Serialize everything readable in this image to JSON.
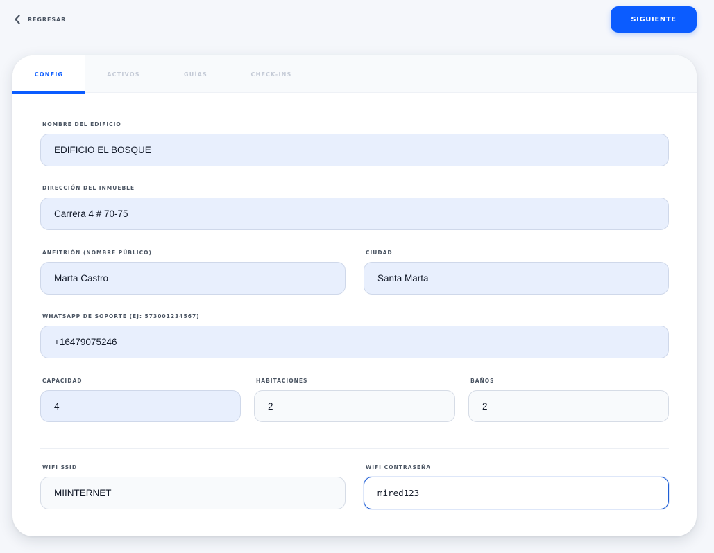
{
  "header": {
    "back_label": "REGRESAR",
    "next_label": "SIGUIENTE"
  },
  "tabs": [
    {
      "label": "CONFIG",
      "active": true
    },
    {
      "label": "ACTIVOS",
      "active": false
    },
    {
      "label": "GUÍAS",
      "active": false
    },
    {
      "label": "CHECK-INS",
      "active": false
    }
  ],
  "form": {
    "building_name": {
      "label": "NOMBRE DEL EDIFICIO",
      "value": "EDIFICIO EL BOSQUE"
    },
    "address": {
      "label": "DIRECCIÓN DEL INMUEBLE",
      "value": "Carrera 4 # 70-75"
    },
    "host": {
      "label": "ANFITRIÓN (NOMBRE PÚBLICO)",
      "value": "Marta Castro"
    },
    "city": {
      "label": "CIUDAD",
      "value": "Santa Marta"
    },
    "whatsapp": {
      "label": "WHATSAPP DE SOPORTE (EJ: 573001234567)",
      "value": "+16479075246"
    },
    "capacity": {
      "label": "CAPACIDAD",
      "value": "4"
    },
    "rooms": {
      "label": "HABITACIONES",
      "value": "2"
    },
    "bathrooms": {
      "label": "BAÑOS",
      "value": "2"
    },
    "wifi_ssid": {
      "label": "WIFI SSID",
      "value": "MIINTERNET"
    },
    "wifi_password": {
      "label": "WIFI CONTRASEÑA",
      "value": "mired123"
    }
  },
  "colors": {
    "accent": "#0b5cff",
    "page_bg": "#f5f7fb",
    "input_filled_bg": "#e8effd",
    "input_default_bg": "#f8fafc"
  }
}
